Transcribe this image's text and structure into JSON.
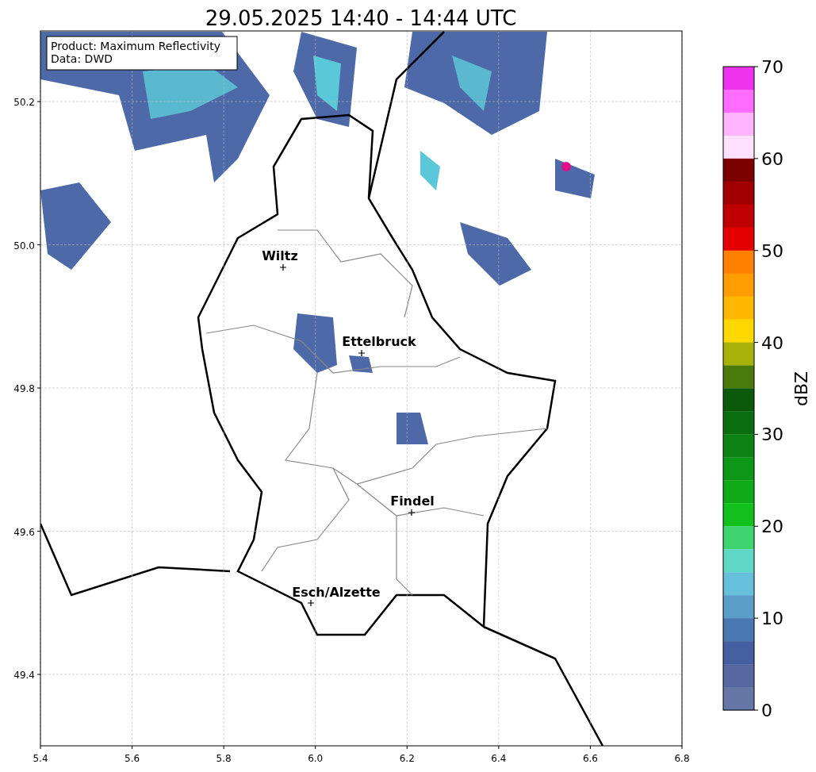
{
  "title": "29.05.2025 14:40 - 14:44 UTC",
  "info_box": [
    "Product: Maximum Reflectivity",
    "Data: DWD"
  ],
  "map": {
    "xticks": [
      "5.4",
      "5.6",
      "5.8",
      "6.0",
      "6.2",
      "6.4",
      "6.6",
      "6.8"
    ],
    "yticks": [
      "50.2",
      "50.0",
      "49.8",
      "49.6",
      "49.4"
    ],
    "places": [
      {
        "name": "Wiltz"
      },
      {
        "name": "Ettelbruck"
      },
      {
        "name": "Findel"
      },
      {
        "name": "Esch/Alzette"
      }
    ]
  },
  "colorbar": {
    "label": "dBZ",
    "ticks": [
      "70",
      "60",
      "50",
      "40",
      "30",
      "20",
      "10",
      "0"
    ],
    "segments": [
      {
        "color": "#ee33ee"
      },
      {
        "color": "#ff6cff"
      },
      {
        "color": "#ffb4ff"
      },
      {
        "color": "#ffe0ff"
      },
      {
        "color": "#7c0000"
      },
      {
        "color": "#a00000"
      },
      {
        "color": "#c00000"
      },
      {
        "color": "#e40000"
      },
      {
        "color": "#ff8000"
      },
      {
        "color": "#ff9c00"
      },
      {
        "color": "#ffb800"
      },
      {
        "color": "#ffd800"
      },
      {
        "color": "#a8b00a"
      },
      {
        "color": "#4a7a0a"
      },
      {
        "color": "#0a5a0a"
      },
      {
        "color": "#0a6e10"
      },
      {
        "color": "#0c8214"
      },
      {
        "color": "#0e9616"
      },
      {
        "color": "#10aa18"
      },
      {
        "color": "#12c01c"
      },
      {
        "color": "#40d470"
      },
      {
        "color": "#60d8c8"
      },
      {
        "color": "#66c0dc"
      },
      {
        "color": "#5a9ec8"
      },
      {
        "color": "#4a78b0"
      },
      {
        "color": "#4460a0"
      },
      {
        "color": "#56689f"
      },
      {
        "color": "#6676a6"
      }
    ]
  }
}
